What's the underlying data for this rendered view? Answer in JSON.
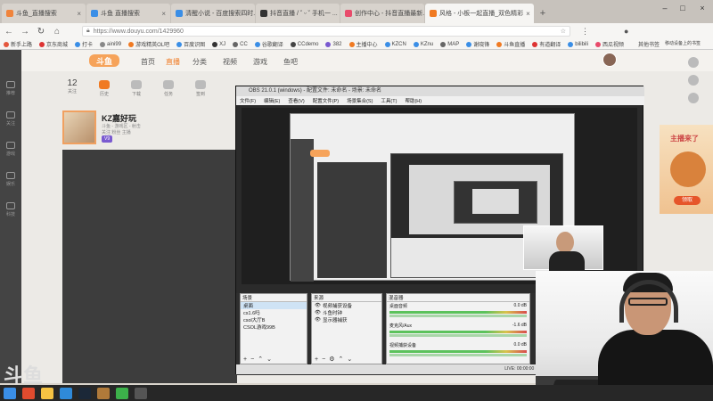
{
  "browser": {
    "tabs": [
      {
        "title": "斗鱼_直播搜索",
        "color": "#f0843c"
      },
      {
        "title": "斗鱼 直播搜索",
        "color": "#3a8ee6"
      },
      {
        "title": "清醒小说 - 百度搜索四时...",
        "color": "#3a8ee6"
      },
      {
        "title": "抖音直播 / ˘ ᵕ ˘ 手机一 ...",
        "color": "#333333"
      },
      {
        "title": "创作中心 - 抖音直播最新...",
        "color": "#e84b6b"
      },
      {
        "title": "风格 - 小板一起直播_双色精彩",
        "color": "#f07a22"
      }
    ],
    "active_tab": 5,
    "new_tab": "+",
    "url": "https://www.douyu.com/1429960",
    "bookmarks": [
      "新手上路",
      "京东商城",
      "打卡",
      "aini99",
      "游戏精英OL吧",
      "百度识图",
      "XJ",
      "CC",
      "谷歌翻译",
      "CCdemo",
      "382",
      "主播中心",
      "KZCN",
      "KZnu",
      "MAP",
      "谢晓锋",
      "斗鱼直播",
      "有道翻译",
      "bilibili",
      "西瓜视频"
    ],
    "bookmarks_right": [
      "其他书签",
      "移动设备上的书签"
    ]
  },
  "site": {
    "logo": "斗鱼",
    "nav": [
      "首页",
      "直播",
      "分类",
      "视频",
      "游戏",
      "鱼吧"
    ],
    "active_nav": 1,
    "subnav": [
      {
        "label": "关注",
        "num": "12"
      },
      {
        "label": "历史",
        "num": ""
      },
      {
        "label": "下载",
        "num": ""
      },
      {
        "label": "任务",
        "num": ""
      },
      {
        "label": "签到",
        "num": ""
      }
    ],
    "streamer": {
      "name": "KZ嘉好玩",
      "meta1": "斗鱼 - 游戏区 - 射击",
      "meta2": "关注 粉丝 主播",
      "badge": "V9"
    },
    "rail": [
      "推荐",
      "关注",
      "游戏",
      "娱乐",
      "科技"
    ],
    "watermark": "斗鱼"
  },
  "ad": {
    "title": "主播来了",
    "button": "领取"
  },
  "obs": {
    "title": "OBS 21.0.1 (windows) - 配置文件: 未命名 - 场景: 未命名",
    "menu": [
      "文件(F)",
      "编辑(E)",
      "查看(V)",
      "配置文件(P)",
      "场景集合(S)",
      "工具(T)",
      "帮助(H)"
    ],
    "scenes_header": "场景",
    "scenes": [
      "桌面",
      "cs1.6吗",
      "csol大厅B",
      "CSOL游戏99B"
    ],
    "sources_header": "来源",
    "sources": [
      "视频捕获设备",
      "斗鱼时钟",
      "显示器捕获"
    ],
    "mixer_header": "混音器",
    "mixer": [
      {
        "name": "桌面音频",
        "db": "0.0 dB"
      },
      {
        "name": "麦克风/Aux",
        "db": "-1.6 dB"
      },
      {
        "name": "视频捕获设备",
        "db": "0.0 dB"
      }
    ],
    "controls_header": "控件",
    "status": "LIVE: 00:00:00  REC: 00:00:00  CPU: 3.1%, 30.00 fps"
  }
}
